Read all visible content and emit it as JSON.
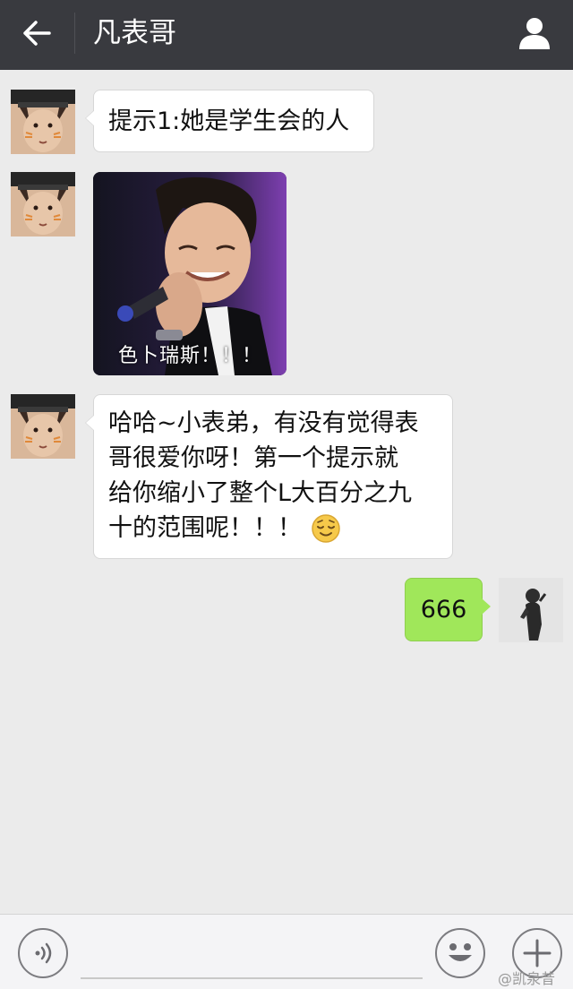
{
  "header": {
    "title": "凡表哥",
    "back_icon": "arrow-left-icon",
    "profile_icon": "user-profile-icon"
  },
  "messages": [
    {
      "sender": "friend",
      "type": "text",
      "text": "提示1:她是学生会的人"
    },
    {
      "sender": "friend",
      "type": "sticker",
      "caption": "色卜瑞斯！！！"
    },
    {
      "sender": "friend",
      "type": "text",
      "lines": [
        "哈哈~小表弟，有没有觉得表",
        "哥很爱你呀！第一个提示就",
        "给你缩小了整个L大百分之九",
        "十的范围呢！！！"
      ],
      "emoji": "relieved-face"
    },
    {
      "sender": "me",
      "type": "text",
      "text": "666"
    }
  ],
  "footer": {
    "voice_icon": "voice-icon",
    "emoji_icon": "emoji-icon",
    "plus_icon": "plus-icon",
    "watermark": "@凯泉昔"
  },
  "colors": {
    "header_bg": "#393a3f",
    "chat_bg": "#ebebeb",
    "incoming_bubble": "#ffffff",
    "outgoing_bubble": "#a0e75a"
  }
}
